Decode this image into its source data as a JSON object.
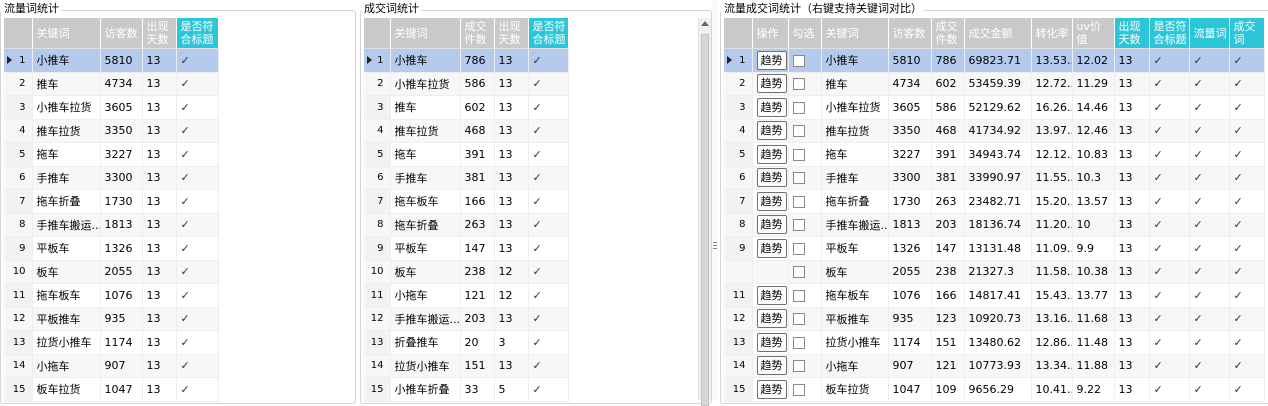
{
  "panel1": {
    "title": "流量词统计",
    "headers": [
      "关键词",
      "访客数",
      "出现天数",
      "是否符合标题"
    ],
    "rows": [
      {
        "n": "1",
        "kw": "小推车",
        "uv": "5810",
        "days": "13",
        "ok": "✓"
      },
      {
        "n": "2",
        "kw": "推车",
        "uv": "4734",
        "days": "13",
        "ok": "✓"
      },
      {
        "n": "3",
        "kw": "小推车拉货",
        "uv": "3605",
        "days": "13",
        "ok": "✓"
      },
      {
        "n": "4",
        "kw": "推车拉货",
        "uv": "3350",
        "days": "13",
        "ok": "✓"
      },
      {
        "n": "5",
        "kw": "拖车",
        "uv": "3227",
        "days": "13",
        "ok": "✓"
      },
      {
        "n": "6",
        "kw": "手推车",
        "uv": "3300",
        "days": "13",
        "ok": "✓"
      },
      {
        "n": "7",
        "kw": "拖车折叠",
        "uv": "1730",
        "days": "13",
        "ok": "✓"
      },
      {
        "n": "8",
        "kw": "手推车搬运...",
        "uv": "1813",
        "days": "13",
        "ok": "✓"
      },
      {
        "n": "9",
        "kw": "平板车",
        "uv": "1326",
        "days": "13",
        "ok": "✓"
      },
      {
        "n": "10",
        "kw": "板车",
        "uv": "2055",
        "days": "13",
        "ok": "✓"
      },
      {
        "n": "11",
        "kw": "拖车板车",
        "uv": "1076",
        "days": "13",
        "ok": "✓"
      },
      {
        "n": "12",
        "kw": "平板推车",
        "uv": "935",
        "days": "13",
        "ok": "✓"
      },
      {
        "n": "13",
        "kw": "拉货小推车",
        "uv": "1174",
        "days": "13",
        "ok": "✓"
      },
      {
        "n": "14",
        "kw": "小拖车",
        "uv": "907",
        "days": "13",
        "ok": "✓"
      },
      {
        "n": "15",
        "kw": "板车拉货",
        "uv": "1047",
        "days": "13",
        "ok": "✓"
      }
    ]
  },
  "panel2": {
    "title": "成交词统计",
    "headers": [
      "关键词",
      "成交件数",
      "出现天数",
      "是否符合标题"
    ],
    "rows": [
      {
        "n": "1",
        "kw": "小推车",
        "qty": "786",
        "days": "13",
        "ok": "✓"
      },
      {
        "n": "2",
        "kw": "小推车拉货",
        "qty": "586",
        "days": "13",
        "ok": "✓"
      },
      {
        "n": "3",
        "kw": "推车",
        "qty": "602",
        "days": "13",
        "ok": "✓"
      },
      {
        "n": "4",
        "kw": "推车拉货",
        "qty": "468",
        "days": "13",
        "ok": "✓"
      },
      {
        "n": "5",
        "kw": "拖车",
        "qty": "391",
        "days": "13",
        "ok": "✓"
      },
      {
        "n": "6",
        "kw": "手推车",
        "qty": "381",
        "days": "13",
        "ok": "✓"
      },
      {
        "n": "7",
        "kw": "拖车板车",
        "qty": "166",
        "days": "13",
        "ok": "✓"
      },
      {
        "n": "8",
        "kw": "拖车折叠",
        "qty": "263",
        "days": "13",
        "ok": "✓"
      },
      {
        "n": "9",
        "kw": "平板车",
        "qty": "147",
        "days": "13",
        "ok": "✓"
      },
      {
        "n": "10",
        "kw": "板车",
        "qty": "238",
        "days": "12",
        "ok": "✓"
      },
      {
        "n": "11",
        "kw": "小拖车",
        "qty": "121",
        "days": "12",
        "ok": "✓"
      },
      {
        "n": "12",
        "kw": "手推车搬运...",
        "qty": "203",
        "days": "13",
        "ok": "✓"
      },
      {
        "n": "13",
        "kw": "折叠推车",
        "qty": "20",
        "days": "3",
        "ok": "✓"
      },
      {
        "n": "14",
        "kw": "拉货小推车",
        "qty": "151",
        "days": "13",
        "ok": "✓"
      },
      {
        "n": "15",
        "kw": "小推车折叠",
        "qty": "33",
        "days": "5",
        "ok": "✓"
      }
    ]
  },
  "panel3": {
    "title": "流量成交词统计（右键支持关键词对比）",
    "headers": [
      "操作",
      "勾选",
      "关键词",
      "访客数",
      "成交件数",
      "成交金额",
      "转化率",
      "uv价值",
      "出现天数",
      "是否符合标题",
      "流量词",
      "成交词"
    ],
    "trend_label": "趋势",
    "rows": [
      {
        "n": "1",
        "btn": true,
        "kw": "小推车",
        "uv": "5810",
        "qty": "786",
        "amt": "69823.71",
        "cvr": "13.53...",
        "uvv": "12.02",
        "days": "13",
        "ok": "✓",
        "f": "✓",
        "d": "✓"
      },
      {
        "n": "2",
        "btn": true,
        "kw": "推车",
        "uv": "4734",
        "qty": "602",
        "amt": "53459.39",
        "cvr": "12.72...",
        "uvv": "11.29",
        "days": "13",
        "ok": "✓",
        "f": "✓",
        "d": "✓"
      },
      {
        "n": "3",
        "btn": true,
        "kw": "小推车拉货",
        "uv": "3605",
        "qty": "586",
        "amt": "52129.62",
        "cvr": "16.26...",
        "uvv": "14.46",
        "days": "13",
        "ok": "✓",
        "f": "✓",
        "d": "✓"
      },
      {
        "n": "4",
        "btn": true,
        "kw": "推车拉货",
        "uv": "3350",
        "qty": "468",
        "amt": "41734.92",
        "cvr": "13.97...",
        "uvv": "12.46",
        "days": "13",
        "ok": "✓",
        "f": "✓",
        "d": "✓"
      },
      {
        "n": "5",
        "btn": true,
        "kw": "拖车",
        "uv": "3227",
        "qty": "391",
        "amt": "34943.74",
        "cvr": "12.12...",
        "uvv": "10.83",
        "days": "13",
        "ok": "✓",
        "f": "✓",
        "d": "✓"
      },
      {
        "n": "6",
        "btn": true,
        "kw": "手推车",
        "uv": "3300",
        "qty": "381",
        "amt": "33990.97",
        "cvr": "11.55...",
        "uvv": "10.3",
        "days": "13",
        "ok": "✓",
        "f": "✓",
        "d": "✓"
      },
      {
        "n": "7",
        "btn": true,
        "kw": "拖车折叠",
        "uv": "1730",
        "qty": "263",
        "amt": "23482.71",
        "cvr": "15.20...",
        "uvv": "13.57",
        "days": "13",
        "ok": "✓",
        "f": "✓",
        "d": "✓"
      },
      {
        "n": "8",
        "btn": true,
        "kw": "手推车搬运...",
        "uv": "1813",
        "qty": "203",
        "amt": "18136.74",
        "cvr": "11.20...",
        "uvv": "10",
        "days": "13",
        "ok": "✓",
        "f": "✓",
        "d": "✓"
      },
      {
        "n": "9",
        "btn": true,
        "kw": "平板车",
        "uv": "1326",
        "qty": "147",
        "amt": "13131.48",
        "cvr": "11.09...",
        "uvv": "9.9",
        "days": "13",
        "ok": "✓",
        "f": "✓",
        "d": "✓"
      },
      {
        "n": "",
        "btn": false,
        "kw": "板车",
        "uv": "2055",
        "qty": "238",
        "amt": "21327.3",
        "cvr": "11.58...",
        "uvv": "10.38",
        "days": "13",
        "ok": "✓",
        "f": "✓",
        "d": "✓"
      },
      {
        "n": "11",
        "btn": true,
        "kw": "拖车板车",
        "uv": "1076",
        "qty": "166",
        "amt": "14817.41",
        "cvr": "15.43...",
        "uvv": "13.77",
        "days": "13",
        "ok": "✓",
        "f": "✓",
        "d": "✓"
      },
      {
        "n": "12",
        "btn": true,
        "kw": "平板推车",
        "uv": "935",
        "qty": "123",
        "amt": "10920.73",
        "cvr": "13.16...",
        "uvv": "11.68",
        "days": "13",
        "ok": "✓",
        "f": "✓",
        "d": "✓"
      },
      {
        "n": "13",
        "btn": true,
        "kw": "拉货小推车",
        "uv": "1174",
        "qty": "151",
        "amt": "13480.62",
        "cvr": "12.86...",
        "uvv": "11.48",
        "days": "13",
        "ok": "✓",
        "f": "✓",
        "d": "✓"
      },
      {
        "n": "14",
        "btn": true,
        "kw": "小拖车",
        "uv": "907",
        "qty": "121",
        "amt": "10773.93",
        "cvr": "13.34...",
        "uvv": "11.88",
        "days": "13",
        "ok": "✓",
        "f": "✓",
        "d": "✓"
      },
      {
        "n": "15",
        "btn": true,
        "kw": "板车拉货",
        "uv": "1047",
        "qty": "109",
        "amt": "9656.29",
        "cvr": "10.41...",
        "uvv": "9.22",
        "days": "13",
        "ok": "✓",
        "f": "✓",
        "d": "✓"
      }
    ]
  },
  "colors": {
    "header_gray": "#c9c9c9",
    "header_cyan": "#2cc6d8",
    "selected_row": "#b5cbee",
    "alt_row": "#f7f7f7"
  }
}
